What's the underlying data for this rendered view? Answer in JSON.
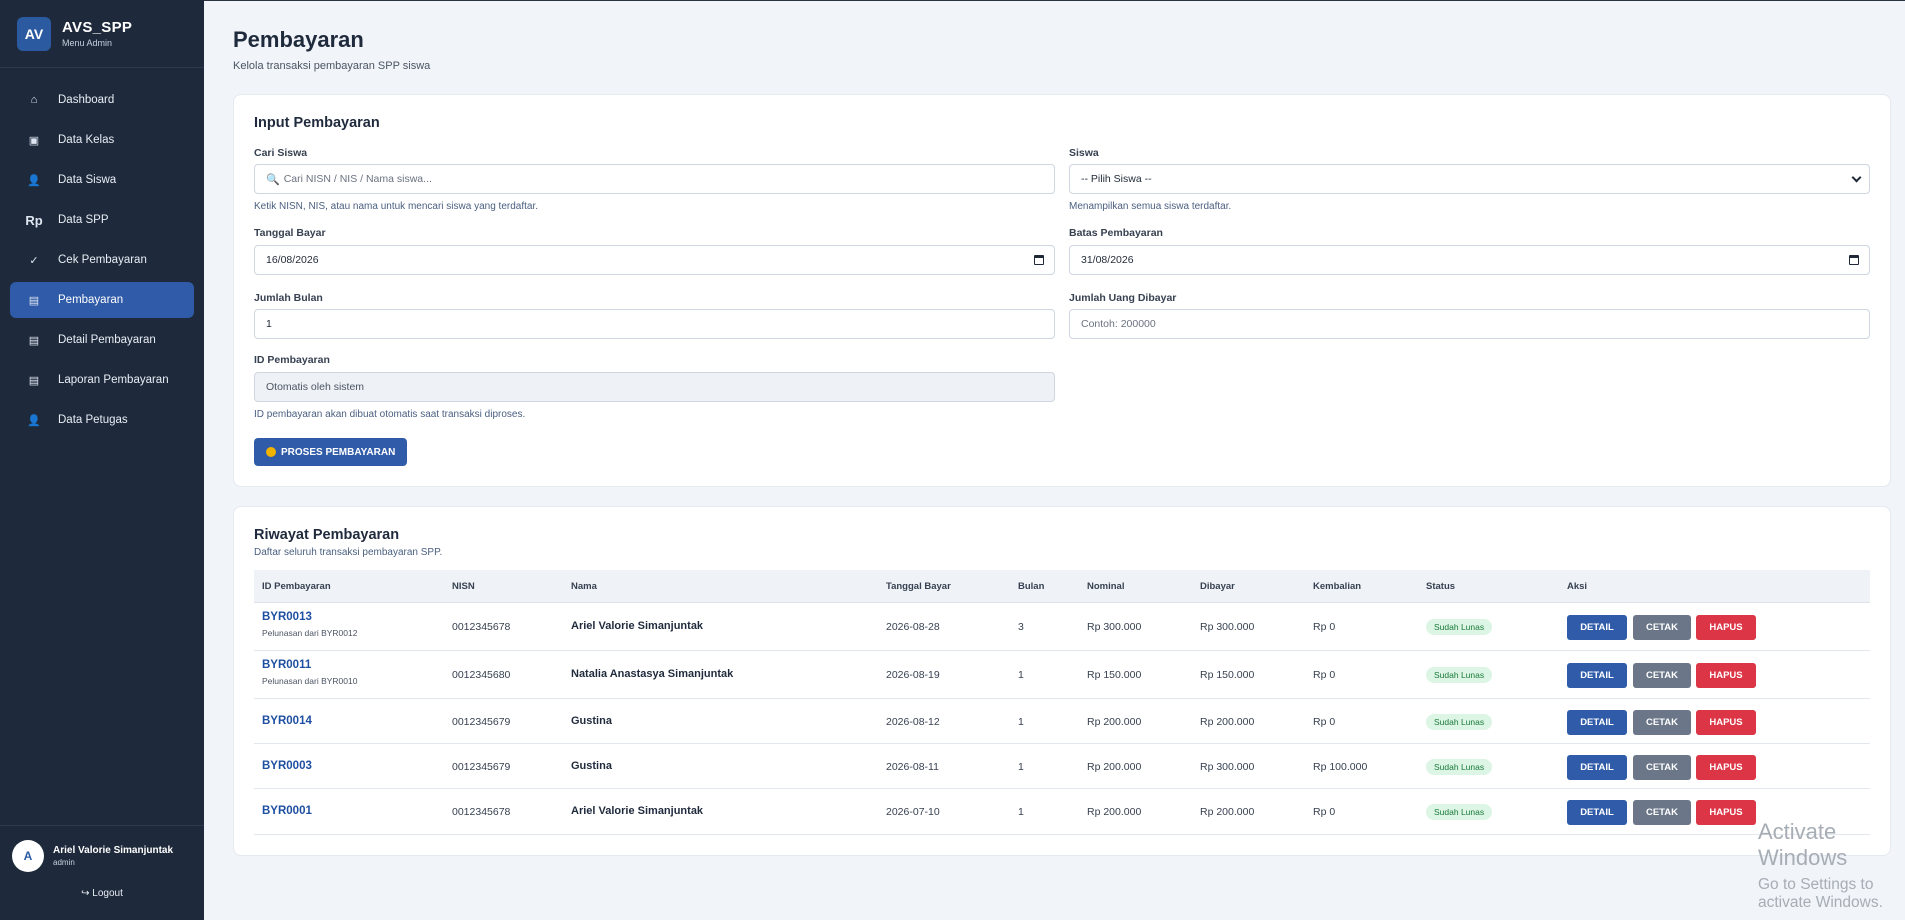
{
  "brand": {
    "logo": "AV",
    "title": "AVS_SPP",
    "subtitle": "Menu Admin"
  },
  "nav": [
    {
      "label": "Dashboard",
      "icon": "⌂",
      "icon_name": "home-icon"
    },
    {
      "label": "Data Kelas",
      "icon": "▣",
      "icon_name": "class-icon"
    },
    {
      "label": "Data Siswa",
      "icon": "👤",
      "icon_name": "student-icon"
    },
    {
      "label": "Data SPP",
      "icon": "Rp",
      "icon_name": "rupiah-icon"
    },
    {
      "label": "Cek Pembayaran",
      "icon": "✓",
      "icon_name": "check-icon"
    },
    {
      "label": "Pembayaran",
      "icon": "▤",
      "icon_name": "list-icon",
      "active": true
    },
    {
      "label": "Detail Pembayaran",
      "icon": "▤",
      "icon_name": "list-icon"
    },
    {
      "label": "Laporan Pembayaran",
      "icon": "▤",
      "icon_name": "list-icon"
    },
    {
      "label": "Data Petugas",
      "icon": "👤",
      "icon_name": "officer-icon"
    }
  ],
  "user": {
    "initial": "A",
    "name": "Ariel Valorie Simanjuntak",
    "role": "admin",
    "logout": "↪ Logout"
  },
  "page": {
    "title": "Pembayaran",
    "subtitle": "Kelola transaksi pembayaran SPP siswa"
  },
  "input_card": {
    "title": "Input Pembayaran",
    "cari_siswa": {
      "label": "Cari Siswa",
      "placeholder": "Cari NISN / NIS / Nama siswa...",
      "hint": "Ketik NISN, NIS, atau nama untuk mencari siswa yang terdaftar."
    },
    "siswa": {
      "label": "Siswa",
      "value": "-- Pilih Siswa --",
      "hint": "Menampilkan semua siswa terdaftar."
    },
    "tanggal_bayar": {
      "label": "Tanggal Bayar",
      "value": "16/08/2026"
    },
    "batas_pembayaran": {
      "label": "Batas Pembayaran",
      "value": "31/08/2026"
    },
    "jumlah_bulan": {
      "label": "Jumlah Bulan",
      "value": "1"
    },
    "jumlah_uang": {
      "label": "Jumlah Uang Dibayar",
      "placeholder": "Contoh: 200000"
    },
    "id_pembayaran": {
      "label": "ID Pembayaran",
      "value": "Otomatis oleh sistem",
      "hint": "ID pembayaran akan dibuat otomatis saat transaksi diproses."
    },
    "submit_label": "PROSES PEMBAYARAN"
  },
  "history": {
    "title": "Riwayat Pembayaran",
    "subtitle": "Daftar seluruh transaksi pembayaran SPP.",
    "columns": [
      "ID Pembayaran",
      "NISN",
      "Nama",
      "Tanggal Bayar",
      "Bulan",
      "Nominal",
      "Dibayar",
      "Kembalian",
      "Status",
      "Aksi"
    ],
    "rows": [
      {
        "id": "BYR0013",
        "note": "Pelunasan dari BYR0012",
        "nisn": "0012345678",
        "nama": "Ariel Valorie Simanjuntak",
        "tanggal": "2026-08-28",
        "bulan": "3",
        "nominal": "Rp 300.000",
        "dibayar": "Rp 300.000",
        "kembalian": "Rp 0",
        "status": "Sudah Lunas"
      },
      {
        "id": "BYR0011",
        "note": "Pelunasan dari BYR0010",
        "nisn": "0012345680",
        "nama": "Natalia Anastasya Simanjuntak",
        "tanggal": "2026-08-19",
        "bulan": "1",
        "nominal": "Rp 150.000",
        "dibayar": "Rp 150.000",
        "kembalian": "Rp 0",
        "status": "Sudah Lunas"
      },
      {
        "id": "BYR0014",
        "note": "",
        "nisn": "0012345679",
        "nama": "Gustina",
        "tanggal": "2026-08-12",
        "bulan": "1",
        "nominal": "Rp 200.000",
        "dibayar": "Rp 200.000",
        "kembalian": "Rp 0",
        "status": "Sudah Lunas"
      },
      {
        "id": "BYR0003",
        "note": "",
        "nisn": "0012345679",
        "nama": "Gustina",
        "tanggal": "2026-08-11",
        "bulan": "1",
        "nominal": "Rp 200.000",
        "dibayar": "Rp 300.000",
        "kembalian": "Rp 100.000",
        "status": "Sudah Lunas"
      },
      {
        "id": "BYR0001",
        "note": "",
        "nisn": "0012345678",
        "nama": "Ariel Valorie Simanjuntak",
        "tanggal": "2026-07-10",
        "bulan": "1",
        "nominal": "Rp 200.000",
        "dibayar": "Rp 200.000",
        "kembalian": "Rp 0",
        "status": "Sudah Lunas"
      }
    ],
    "actions": {
      "detail": "DETAIL",
      "cetak": "CETAK",
      "hapus": "HAPUS"
    }
  },
  "watermark": {
    "line1": "Activate Windows",
    "line2": "Go to Settings to activate Windows."
  },
  "colors": {
    "sidebar": "#1e2a3b",
    "accent": "#2f5ba8",
    "danger": "#dc3545",
    "muted_button": "#6b7789",
    "success_badge": "#dcf5e4"
  }
}
